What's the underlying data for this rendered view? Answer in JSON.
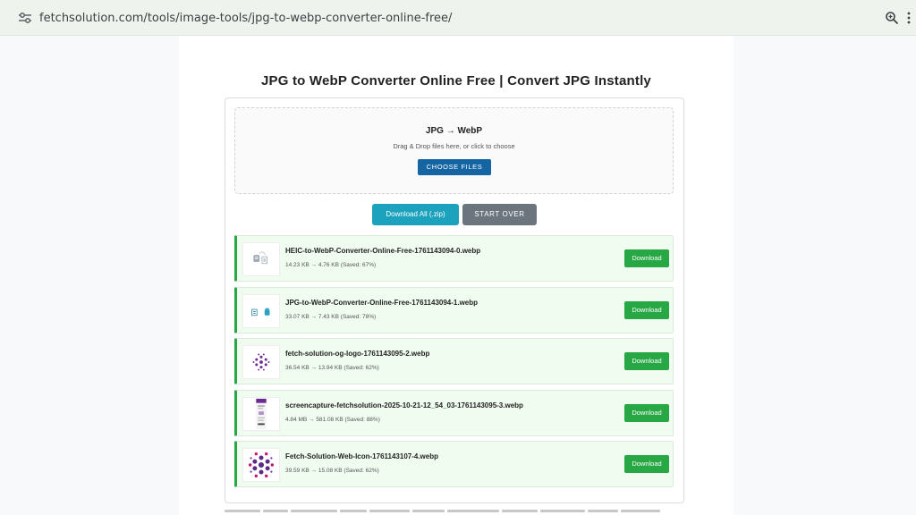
{
  "browser": {
    "url": "fetchsolution.com/tools/image-tools/jpg-to-webp-converter-online-free/"
  },
  "page": {
    "title": "JPG to WebP Converter Online Free | Convert JPG Instantly"
  },
  "dropzone": {
    "title": "JPG → WebP",
    "subtitle": "Drag & Drop files here, or click to choose",
    "choose_label": "CHOOSE FILES"
  },
  "actions": {
    "download_all_label": "Download All (.zip)",
    "start_over_label": "START OVER"
  },
  "files": [
    {
      "name": "HEIC-to-WebP-Converter-Online-Free-1761143094-0.webp",
      "meta": "14.23 KB → 4.76 KB (Saved: 67%)",
      "download_label": "Download",
      "thumb": "document-icons"
    },
    {
      "name": "JPG-to-WebP-Converter-Online-Free-1761143094-1.webp",
      "meta": "33.07 KB → 7.43 KB (Saved: 78%)",
      "download_label": "Download",
      "thumb": "document-icons"
    },
    {
      "name": "fetch-solution-og-logo-1761143095-2.webp",
      "meta": "36.54 KB → 13.94 KB (Saved: 62%)",
      "download_label": "Download",
      "thumb": "dot-logo-small"
    },
    {
      "name": "screencapture-fetchsolution-2025-10-21-12_54_03-1761143095-3.webp",
      "meta": "4.84 MB → 581.08 KB (Saved: 88%)",
      "download_label": "Download",
      "thumb": "page-screenshot"
    },
    {
      "name": "Fetch-Solution-Web-Icon-1761143107-4.webp",
      "meta": "39.59 KB → 15.08 KB (Saved: 62%)",
      "download_label": "Download",
      "thumb": "dot-logo-large"
    }
  ],
  "colors": {
    "primary": "#1565a3",
    "info": "#1ca2bd",
    "secondary": "#6c757d",
    "success": "#28a745",
    "logo_purple": "#6a2c91"
  }
}
